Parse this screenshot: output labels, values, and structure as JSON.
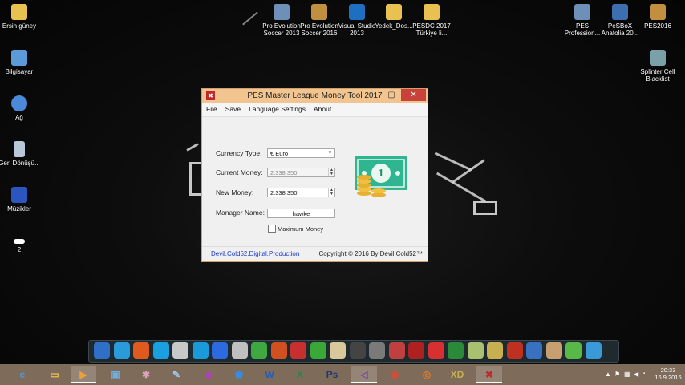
{
  "window": {
    "title": "PES Master League Money Tool 2017",
    "menu": [
      "File",
      "Save",
      "Language Settings",
      "About"
    ],
    "currency_label": "Currency Type:",
    "currency_value": "€ Euro",
    "current_money_label": "Current Money:",
    "current_money_value": "2.338.350",
    "new_money_label": "New Money:",
    "new_money_value": "2.338.350",
    "manager_label": "Manager Name:",
    "manager_value": "hawke",
    "max_money_label": "Maximum Money",
    "footer_link": "Devil.Cold52.Digital.Production",
    "footer_copy": "Copyright © 2016 By Devil Cold52™",
    "money_icon_digit": "1"
  },
  "desktop_left": [
    {
      "label": "Ersin güney",
      "icon": "folder-icon",
      "color": "#e8c150"
    },
    {
      "label": "Bilgisayar",
      "icon": "computer-icon",
      "color": "#5a9ad8"
    },
    {
      "label": "Ağ",
      "icon": "network-icon",
      "color": "#4a8ad8"
    },
    {
      "label": "Geri Dönüşü...",
      "icon": "recycle-bin-icon",
      "color": "#b8c8d8"
    },
    {
      "label": "Müzikler",
      "icon": "music-folder-icon",
      "color": "#2b56c0"
    },
    {
      "label": "2",
      "icon": "drive-icon",
      "color": "#ffffff"
    }
  ],
  "desktop_top": [
    {
      "label": "Pro Evolution Soccer 2013",
      "icon": "pes2013-icon",
      "color": "#6d8fb8"
    },
    {
      "label": "Pro Evolution Soccer 2016",
      "icon": "pes2016-icon",
      "color": "#c09040"
    },
    {
      "label": "Visual Studio 2013",
      "icon": "visual-studio-icon",
      "color": "#1f6fc0"
    },
    {
      "label": "Yedek_Dos...",
      "icon": "folder-icon",
      "color": "#e8c150"
    },
    {
      "label": "PESDC 2017 Türkiye li...",
      "icon": "folder-icon",
      "color": "#e8c150"
    }
  ],
  "desktop_right": [
    {
      "label": "PES Profession...",
      "icon": "pes-icon",
      "color": "#6d8fb8"
    },
    {
      "label": "PeSBoX Anatolia 20...",
      "icon": "pesbox-icon",
      "color": "#3d6eb0"
    },
    {
      "label": "PES2016",
      "icon": "pes2016-icon",
      "color": "#c09040"
    },
    {
      "label": "Splinter Cell Blacklist",
      "icon": "splinter-cell-icon",
      "color": "#7aa0a8"
    }
  ],
  "dock_colors": [
    "#2f6fc8",
    "#2a9ad8",
    "#e05a20",
    "#1aa0e0",
    "#c8c8c8",
    "#1a9ad8",
    "#2d6ae0",
    "#c0c0c0",
    "#40a840",
    "#d05020",
    "#c83030",
    "#3aa838",
    "#d8c89a",
    "#444444",
    "#7a7a7a",
    "#c04040",
    "#b02020",
    "#d83030",
    "#2a8a3a",
    "#a8c070",
    "#c8b050",
    "#c03020",
    "#3a70c0",
    "#c8a070",
    "#58b848",
    "#3a9ad8"
  ],
  "taskbar": {
    "items": [
      {
        "name": "ie-icon",
        "glyph": "e",
        "color": "#3aa0e8"
      },
      {
        "name": "file-explorer-icon",
        "glyph": "▭",
        "color": "#e8c150"
      },
      {
        "name": "media-player-icon",
        "glyph": "▶",
        "color": "#e8a040"
      },
      {
        "name": "remote-desktop-icon",
        "glyph": "▣",
        "color": "#6ab0e0"
      },
      {
        "name": "paint-icon",
        "glyph": "✱",
        "color": "#e0a0c0"
      },
      {
        "name": "tool-icon",
        "glyph": "✎",
        "color": "#a0c8e8"
      },
      {
        "name": "shield-app-icon",
        "glyph": "◆",
        "color": "#b040c0"
      },
      {
        "name": "security-icon",
        "glyph": "⬟",
        "color": "#3a8ae0"
      },
      {
        "name": "word-icon",
        "glyph": "W",
        "color": "#2b5cb0"
      },
      {
        "name": "excel-icon",
        "glyph": "X",
        "color": "#21884a"
      },
      {
        "name": "photoshop-icon",
        "glyph": "Ps",
        "color": "#1a3a70"
      },
      {
        "name": "visual-studio-icon",
        "glyph": "◁",
        "color": "#7a4ab0"
      },
      {
        "name": "chrome-icon",
        "glyph": "◉",
        "color": "#d84a3a"
      },
      {
        "name": "firefox-icon",
        "glyph": "◎",
        "color": "#e87a20"
      },
      {
        "name": "xd-app-icon",
        "glyph": "XD",
        "color": "#c8b050"
      },
      {
        "name": "money-tool-icon",
        "glyph": "✖",
        "color": "#c0282b"
      }
    ],
    "time": "20:33",
    "date": "16.9.2016"
  }
}
